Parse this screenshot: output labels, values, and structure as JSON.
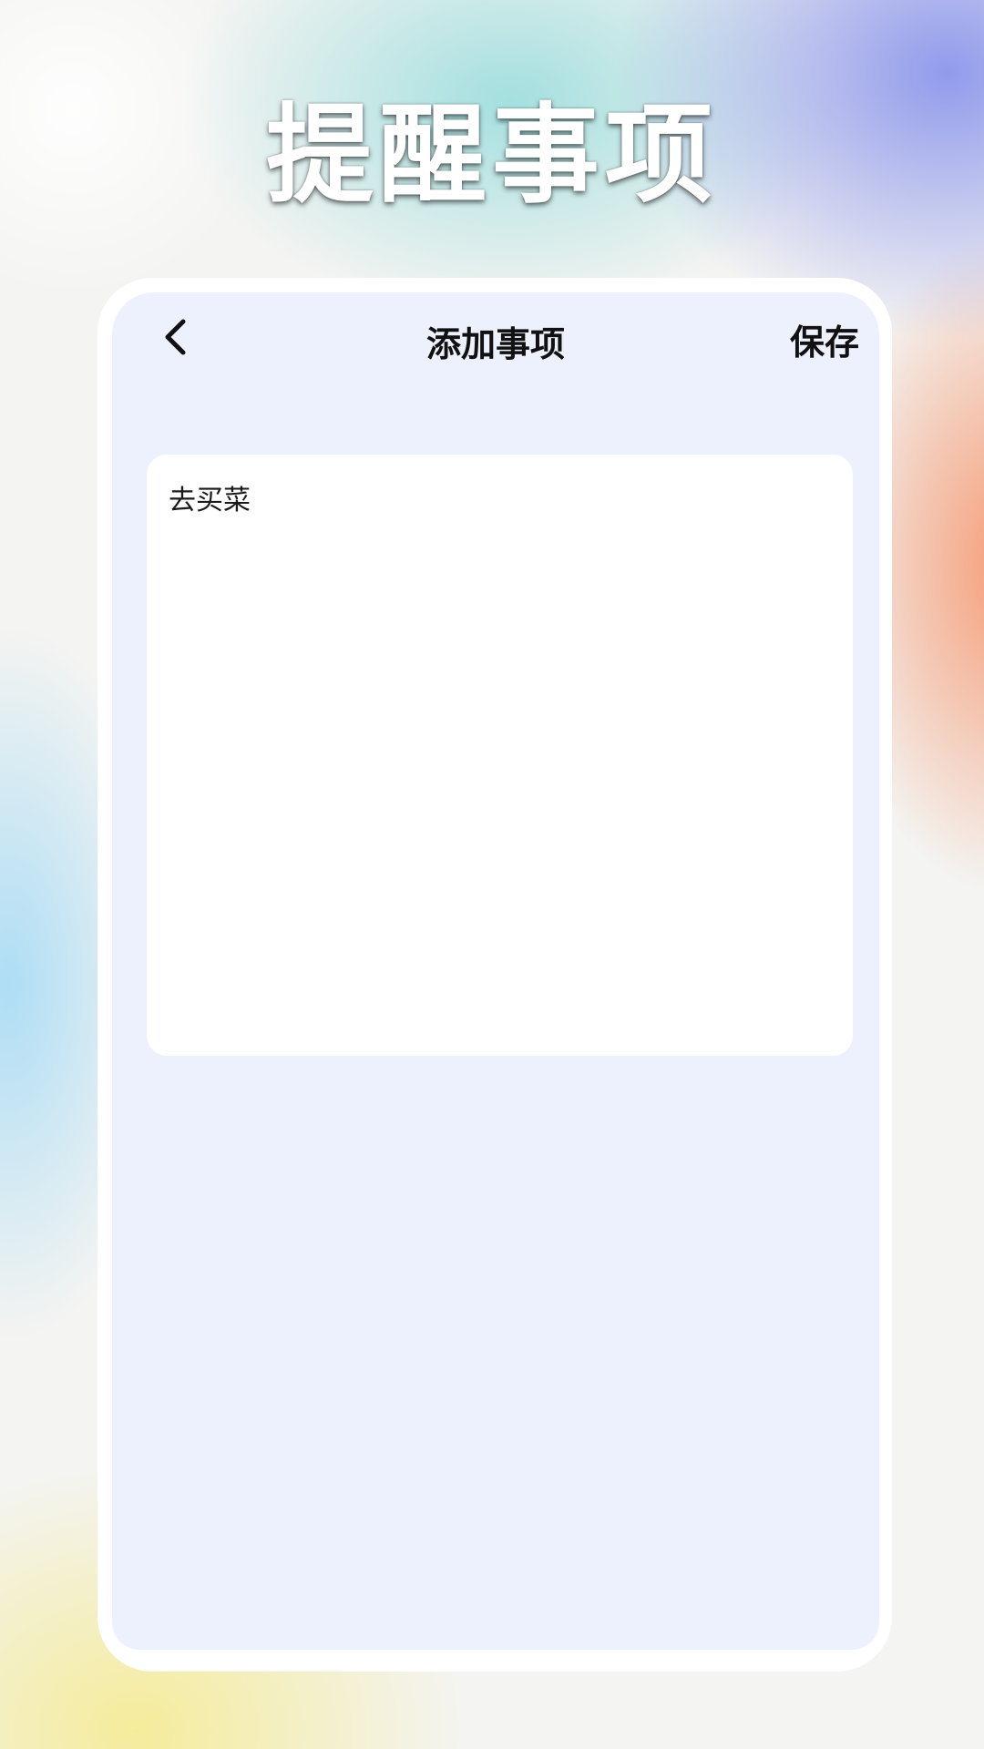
{
  "banner": {
    "title": "提醒事项"
  },
  "header": {
    "back_icon": "chevron-left-icon",
    "title": "添加事项",
    "save_label": "保存"
  },
  "note": {
    "value": "去买菜"
  },
  "colors": {
    "screen_bg": "#edf1fd",
    "card_bg": "#ffffff",
    "text": "#111111"
  }
}
